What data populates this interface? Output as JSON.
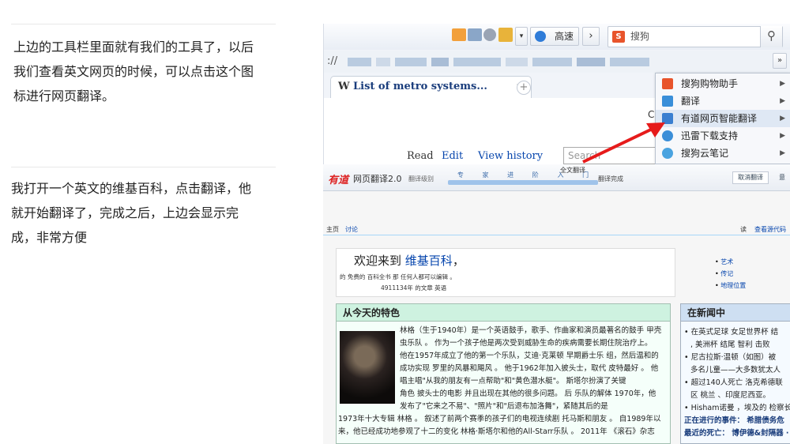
{
  "article": {
    "para1": [
      "上边的工具栏里面就有我们的工具了，以后",
      "我们查看英文网页的时候，可以点击这个图",
      "标进行网页翻译。"
    ],
    "para2": [
      "我打开一个英文的维基百科，点击翻译，他",
      "就开始翻译了，完成之后，上边会显示完",
      "成，非常方便"
    ]
  },
  "browser": {
    "speed_label": "高速",
    "search_placeholder": "搜狗",
    "tab_title": "List of metro systems...",
    "wiki_tabs": [
      "Read",
      "Edit",
      "View history"
    ],
    "wiki_search_placeholder": "Search",
    "menu_items": [
      "搜狗购物助手",
      "翻译",
      "有道网页智能翻译",
      "迅雷下载支持",
      "搜狗云笔记"
    ],
    "menu_icon_colors": [
      "#e8542b",
      "#3a8fd9",
      "#3a7fd0",
      "#3b8ed8",
      "#4aa3e0"
    ]
  },
  "translate_bar": {
    "logo": "有道",
    "title": "网页翻译2.0",
    "mode_label": "翻译级别",
    "levels": [
      "专",
      "家",
      "进",
      "阶",
      "入",
      "门"
    ],
    "done_label": "全文翻译",
    "status": "翻译完成",
    "cancel": "取消翻译",
    "extra": "意"
  },
  "wiki": {
    "nav_left": [
      "主页",
      "讨论"
    ],
    "nav_right": [
      "读",
      "查看源代码"
    ],
    "welcome_prefix": "欢迎来到",
    "welcome_link": "维基百科",
    "welcome_comma": "，",
    "welcome_sub1": "的 免费的 百科全书 那 任何人都可以编辑 。",
    "welcome_sub2": "4911134年 的文章 英语",
    "portals": [
      "艺术",
      "传记",
      "地理位置"
    ],
    "featured_title": "从今天的特色",
    "featured_lines": [
      "林格（生于1940年）是一个英语鼓手，歌手、作曲家和演员最著名的鼓手 甲壳",
      "虫乐队 。 作为一个孩子他是两次受到威胁生命的疾病需要长期住院治疗上。",
      "他在1957年成立了他的第一个乐队，艾迪·克莱顿 早期爵士乐 组，然后温和的",
      "成功实现 罗里的风暴和飓风 。 他于1962年加入披头士，取代 皮特最好 。 他",
      "唱主唱\"从我的朋友有一点帮助\"和\"黄色潜水艇\"。 斯塔尔扮演了关键",
      "角色 披头士的电影 并且出现在其他的很多问题。 后 乐队的解体 1970年，他",
      "发布了\"它来之不易\"、\"照片\"和\"后退布加洛舞\"，紧随其后的是",
      "1973年十大专辑 林格 。 叙述了前两个赛季的孩子们的电视连续剧 托马斯和朋友 。 自1989年以",
      "来，他已经成功地参观了十二的变化 林格·斯塔尔和他的All-Starr乐队 。 2011年 《滚石》杂志"
    ],
    "news_title": "在新闻中",
    "news_lines": [
      "在英式足球 女足世界杯 结",
      ", 美洲杯 结尾 智利 击败",
      "尼古拉斯·温顿（如图）被",
      "多名儿童——大多数犹太人",
      "超过140人死亡 洛克希德联",
      "区 桃兰 、印度尼西亚。",
      "Hisham诺曼 ，埃及的 检察长",
      "正在进行的事件： 希腊债务危",
      "最近的死亡： 博伊德&封隔器 ·"
    ]
  }
}
